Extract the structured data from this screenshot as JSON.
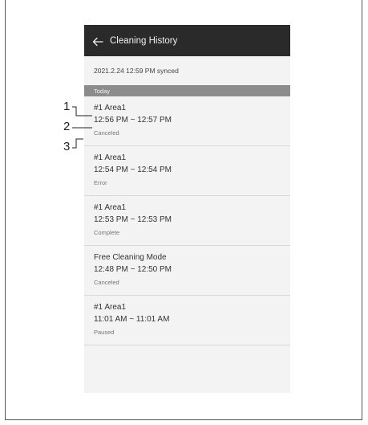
{
  "app": {
    "title": "Cleaning History",
    "back_icon": "arrow-left-icon"
  },
  "sync_status": "2021.2.24 12:59 PM synced",
  "section_label": "Today",
  "history_items": [
    {
      "title": "#1 Area1",
      "time": "12:56 PM ~ 12:57 PM",
      "status": "Canceled"
    },
    {
      "title": "#1 Area1",
      "time": "12:54 PM ~ 12:54 PM",
      "status": "Error"
    },
    {
      "title": "#1 Area1",
      "time": "12:53 PM ~ 12:53 PM",
      "status": "Complete"
    },
    {
      "title": "Free Cleaning Mode",
      "time": "12:48 PM ~ 12:50 PM",
      "status": "Canceled"
    },
    {
      "title": "#1 Area1",
      "time": "11:01 AM ~ 11:01 AM",
      "status": "Paused"
    }
  ],
  "callouts": [
    "1",
    "2",
    "3"
  ],
  "colors": {
    "appbar": "#2a2a2a",
    "section_header": "#8c8c8c",
    "screen_background": "#f3f3f3"
  }
}
